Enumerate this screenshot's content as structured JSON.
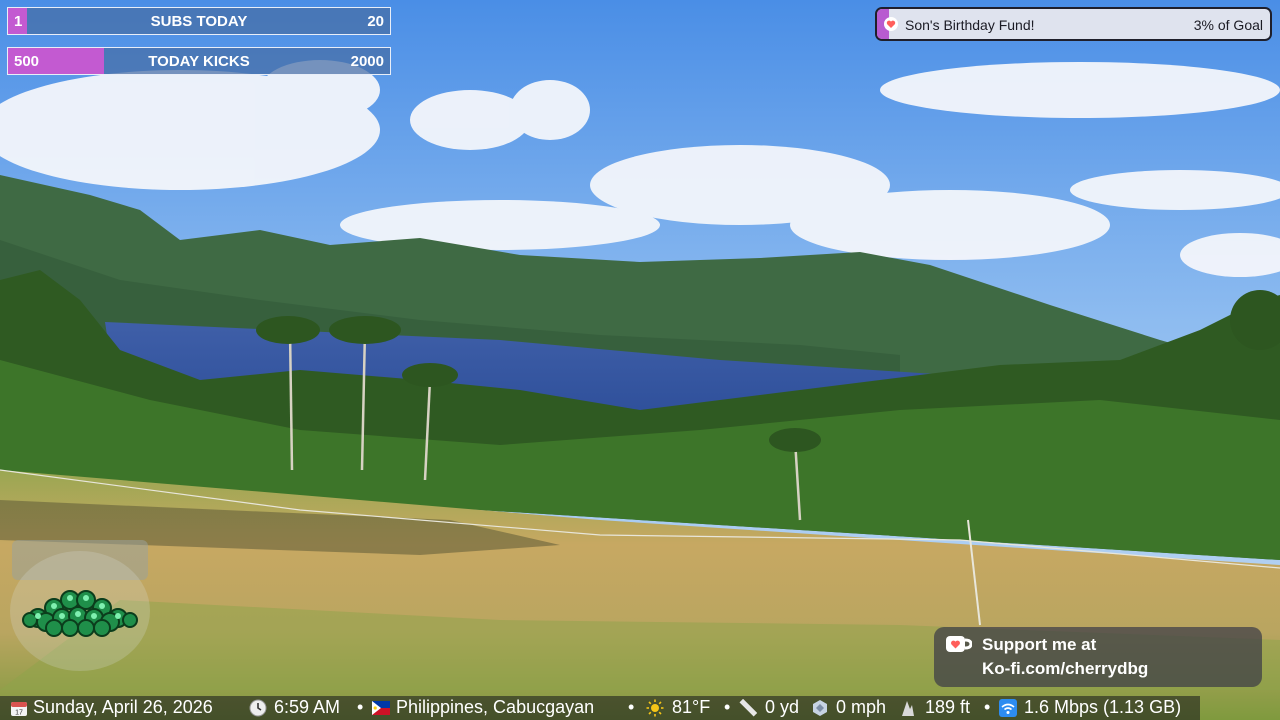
{
  "overlay": {
    "subs_goal": {
      "current": "1",
      "title": "SUBS TODAY",
      "max": "20",
      "progress": 0.05
    },
    "kicks_goal": {
      "current": "500",
      "title": "TODAY KICKS",
      "max": "2000",
      "progress": 0.25
    },
    "fund": {
      "icon": "kofi-heart-icon",
      "label": "Son's Birthday Fund!",
      "percent_label": "3% of Goal",
      "progress": 0.03
    },
    "kofi": {
      "icon": "kofi-cup-icon",
      "line1": "Support me at",
      "line2": "Ko-fi.com/cherrydbg"
    }
  },
  "info_bar": {
    "date": "Sunday, April 26, 2026",
    "time": "6:59 AM",
    "location": "Philippines,  Cabucgayan",
    "temperature": "81°F",
    "distance": "0 yd",
    "speed": "0 mph",
    "altitude": "189 ft",
    "network": "1.6 Mbps (1.13 GB)",
    "separator": "•",
    "icons": [
      "calendar-icon",
      "clock-icon",
      "philippines-flag-icon",
      "sun-icon",
      "ruler-icon",
      "speed-icon",
      "altitude-icon",
      "wifi-icon"
    ]
  },
  "colors": {
    "accent_purple": "#c35ad1",
    "bar_blue": "#466ea5",
    "kofi_red": "#ff5e5b"
  }
}
